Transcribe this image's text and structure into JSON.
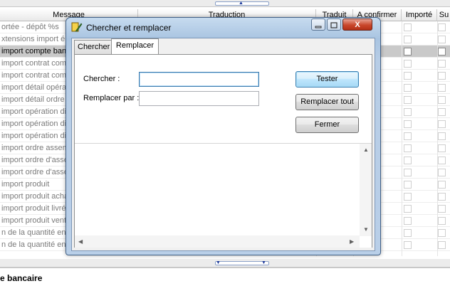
{
  "grid": {
    "headers": [
      "Message",
      "Traduction",
      "Traduit",
      "A confirmer",
      "Importé",
      "Su"
    ],
    "rows": [
      "ortée - dépôt %s",
      "xtensions import é",
      "import compte banc",
      "import contrat comm",
      "import contrat comm",
      "import détail opératio",
      "import détail ordre d",
      "import opération div",
      "import opération div",
      "import opération div",
      "import ordre assemb",
      "import ordre d'assen",
      "import ordre d'assen",
      "import produit",
      "import produit achat",
      "import produit livré",
      "import produit vente",
      "n de la quantité en s",
      "n de la quantité en s"
    ],
    "selected_index": 2
  },
  "bottom": {
    "label": "e bancaire"
  },
  "dialog": {
    "title": "Chercher et remplacer",
    "tabs": [
      "Chercher",
      "Remplacer"
    ],
    "active_tab": "Remplacer",
    "search_label": "Chercher :",
    "search_value": "",
    "replace_label": "Remplacer par :",
    "replace_value": "",
    "buttons": {
      "test": "Tester",
      "replace_all": "Remplacer tout",
      "close": "Fermer"
    },
    "caption_buttons": {
      "minimize": "▭",
      "maximize": "□",
      "close": "X"
    }
  },
  "icons": {
    "app": "app-icon",
    "splitter_up": "chevron-up-icon",
    "splitter_down": "chevron-down-icon",
    "scroll_up": "scroll-up-icon",
    "scroll_down": "scroll-down-icon",
    "scroll_left": "scroll-left-icon",
    "scroll_right": "scroll-right-icon"
  },
  "colors": {
    "selected_row": "#c9c9c9",
    "default_button": "#3c7fb1",
    "dialog_frame": "#a9c4e1"
  }
}
